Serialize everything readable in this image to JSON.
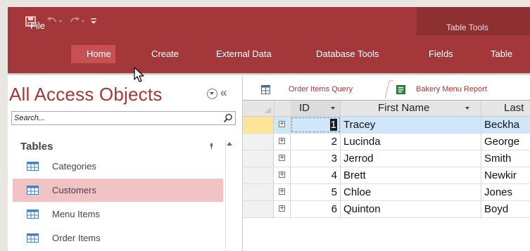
{
  "quick_access": {
    "icons": [
      "save-icon",
      "undo-icon",
      "redo-icon",
      "customize-icon"
    ]
  },
  "context_group": {
    "title": "Table Tools"
  },
  "ribbon_tabs": [
    {
      "label": "File"
    },
    {
      "label": "Home",
      "active": true
    },
    {
      "label": "Create"
    },
    {
      "label": "External Data"
    },
    {
      "label": "Database Tools"
    },
    {
      "label": "Fields"
    },
    {
      "label": "Table"
    }
  ],
  "nav_pane": {
    "title": "All Access Objects",
    "search_placeholder": "Search...",
    "group_label": "Tables",
    "items": [
      {
        "label": "Categories",
        "selected": false
      },
      {
        "label": "Customers",
        "selected": true
      },
      {
        "label": "Menu Items",
        "selected": false
      },
      {
        "label": "Order Items",
        "selected": false
      }
    ]
  },
  "doc_tabs": [
    {
      "label": "Order Items Query",
      "icon": "query-icon"
    },
    {
      "label": "Bakery Menu Report",
      "icon": "report-icon"
    }
  ],
  "datasheet": {
    "columns": [
      "ID",
      "First Name",
      "Last"
    ],
    "rows": [
      {
        "id": "1",
        "first": "Tracey",
        "last": "Beckha",
        "current": true
      },
      {
        "id": "2",
        "first": "Lucinda",
        "last": "George"
      },
      {
        "id": "3",
        "first": "Jerrod",
        "last": "Smith"
      },
      {
        "id": "4",
        "first": "Brett",
        "last": "Newkir"
      },
      {
        "id": "5",
        "first": "Chloe",
        "last": "Jones"
      },
      {
        "id": "6",
        "first": "Quinton",
        "last": "Boyd"
      }
    ]
  },
  "colors": {
    "access_red": "#a4373a",
    "active_tab": "#c85052",
    "selected_item": "#f2c3c4",
    "current_row": "#cfe6fb"
  }
}
